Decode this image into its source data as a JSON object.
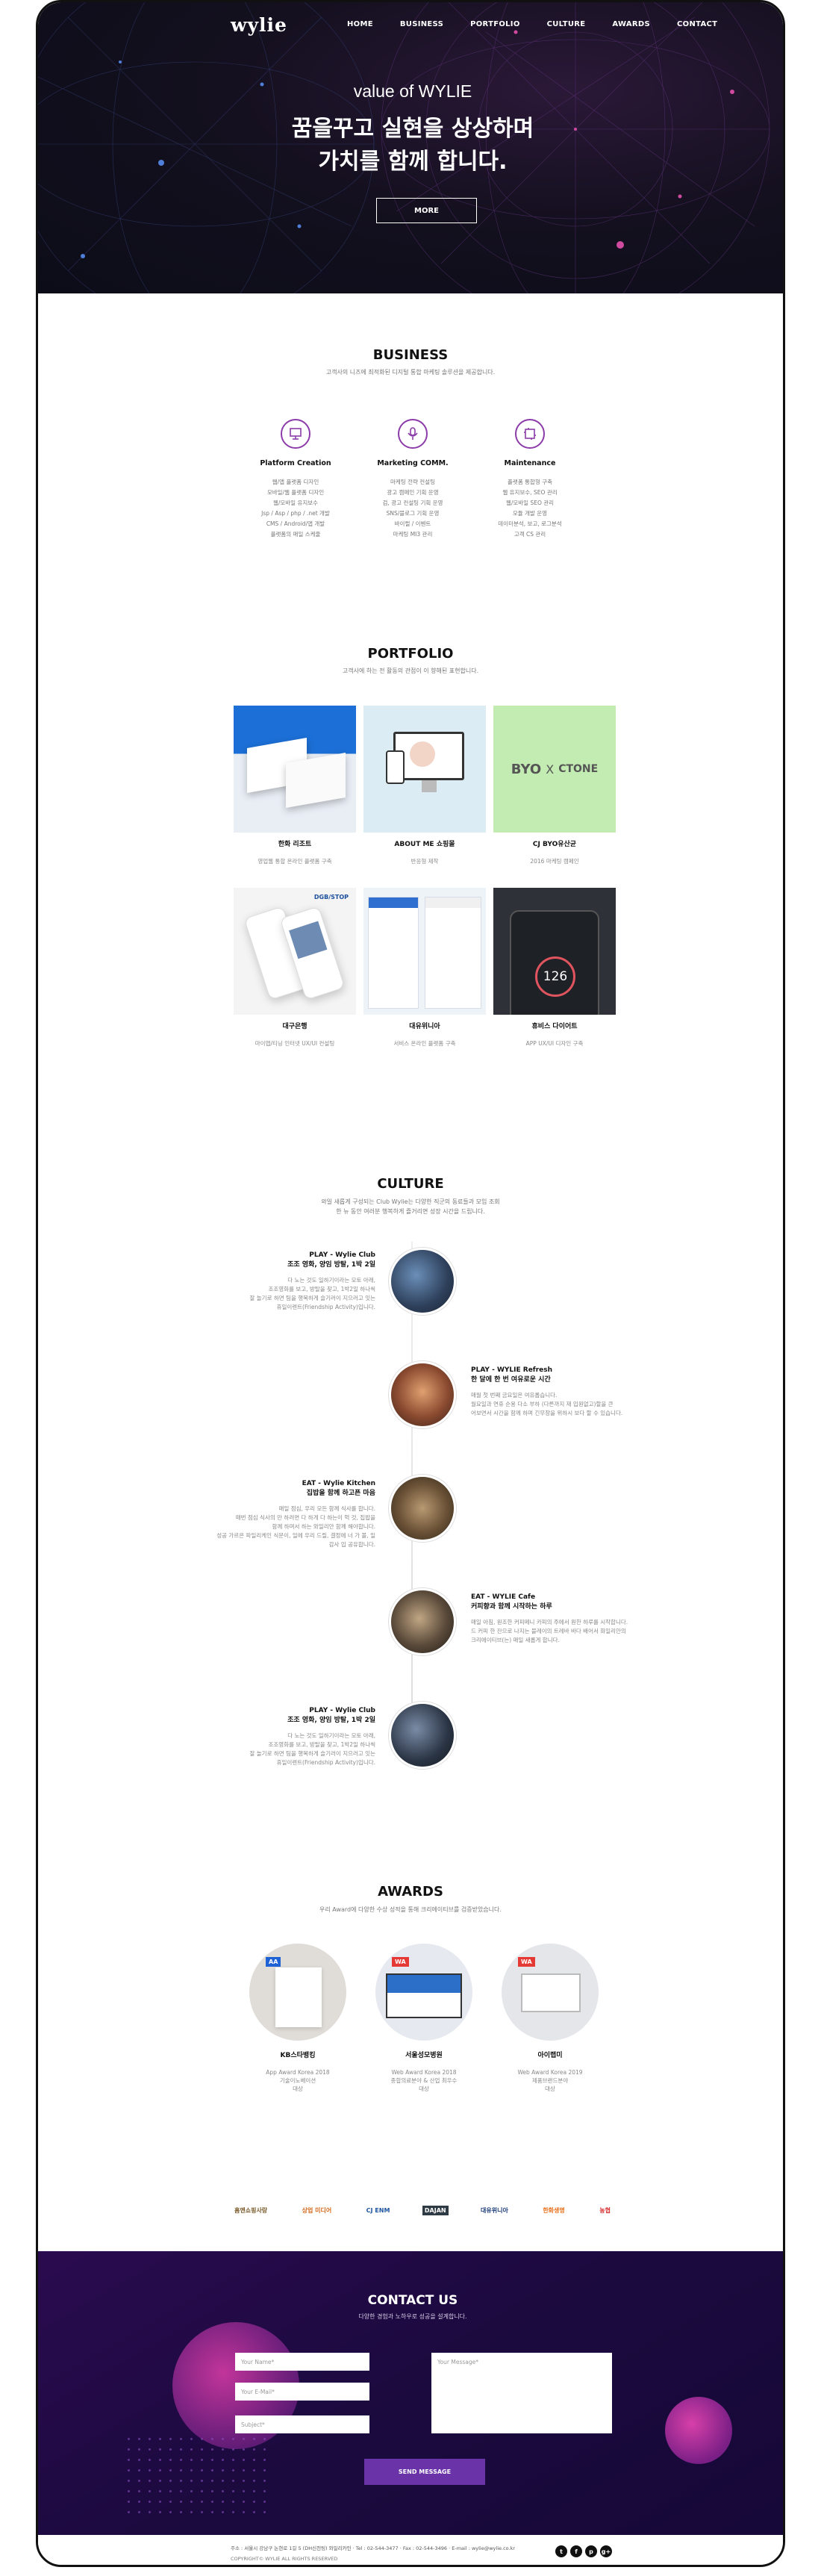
{
  "nav": {
    "logo": "wylie",
    "items": [
      "HOME",
      "BUSINESS",
      "PORTFOLIO",
      "CULTURE",
      "AWARDS",
      "CONTACT"
    ]
  },
  "hero": {
    "subtitle": "value of WYLIE",
    "title_line1": "꿈을꾸고 실현을 상상하며",
    "title_line2": "가치를 함께 합니다.",
    "more_label": "MORE"
  },
  "business": {
    "title": "BUSINESS",
    "desc": "고객사의 니즈에 최적화된 디지털 통합 마케팅 솔루션을 제공합니다.",
    "items": [
      {
        "icon": "platform-icon",
        "name": "Platform Creation",
        "desc": "웹/앱 플랫폼 디자인\n모바일/웹 플랫폼 디자인\n웹/모바일 유지보수\nJsp / Asp / php / .net 개발\nCMS / Android/앱 개발\n플랫폼의 매일 스케줄"
      },
      {
        "icon": "marketing-icon",
        "name": "Marketing COMM.",
        "desc": "마케팅 전략 컨설팅\n광고 캠페인 기획 운영\n검, 광고 컨설팅 기획 운영\nSNS/블로그 기획 운영\n바이럴 / 이벤트\n마케팅 MI3 관리"
      },
      {
        "icon": "maintenance-icon",
        "name": "Maintenance",
        "desc": "플랫폼 통합형 구축\n웹 유지보수, SEO 관리\n웹/모바일 SEO 관리\n모듈 개발 운영\n데이터분석, 보고, 로그분석\n고객 CS 관리"
      }
    ]
  },
  "portfolio": {
    "title": "PORTFOLIO",
    "desc": "고객사에 하는 전 활동의 관점이 이 향해된 표현합니다.",
    "items": [
      {
        "name": "한화 리조트",
        "desc": "영업웹 통합 온라인 플랫폼 구축"
      },
      {
        "name": "ABOUT ME 쇼핑몰",
        "desc": "반응형 제작"
      },
      {
        "name": "CJ BYO유산균",
        "desc": "2016 마케팅 캠페인"
      },
      {
        "name": "대구은행",
        "desc": "마이앱/티닝 인터넷 UX/UI 컨설팅"
      },
      {
        "name": "대유위니아",
        "desc": "서비스 온라인 플랫폼 구축"
      },
      {
        "name": "휴비스 다이어트",
        "desc": "APP UX/UI 디자인 구축"
      }
    ],
    "byo_text": "BYO",
    "x_text": "X",
    "ctone_text": "CTONE",
    "dgb_text": "DGB/STOP",
    "phone_number": "126"
  },
  "culture": {
    "title": "CULTURE",
    "desc_line1": "와일 새롭게 구성되는 Club Wylie는 다양한 직군의 동료들과 모임 조회",
    "desc_line2": "한 뉴 동안 여러분 행복하게 즐거리면 성장 시간을 드립니다.",
    "items": [
      {
        "title": "PLAY - Wylie Club\n조조 영화, 양임 방탈, 1박 2일",
        "desc": "다 노는 것도 일하기이라는 모토 아래,\n조조영화를 보고, 방탈을 찾고, 1박2일 하나씩 \n잘 놀기로 하면 팀을 행복하게 슬기러이 지으러고 잇는\n휴일이렌트(Friendship Activity)입니다."
      },
      {
        "title": "PLAY - WYLIE Refresh\n한 달에 한 번 여유로운 시간",
        "desc": "매월 첫 번째 금요일은 여유롭습니다.\n월요일과 연휴 순용 다소 부하 (다른까지 재 입원없고)할을 큰\n어보면서 시간을 함께 하며 긴무장을 위하시 보다 할 수 있습니다."
      },
      {
        "title": "EAT - Wylie Kitchen\n집밥을 함께 하고픈 마음",
        "desc": "매일 점심, 우리 모든 함께 식사를 합니다.\n매번 점심 식사의 만 하려면 다 하게 다 하는이 먹 것, 집밥을\n함께 하며서 하는 와일리안 함께 해야합니다.\n성공 가르은 파일리케인 식문이, 일에 우리 드릴, 결정에 너 가 볼, 일\n감사 입 공유합니다."
      },
      {
        "title": "EAT - WYLIE Cafe\n커피향과 함께 시작하는 하루",
        "desc": "매일 아침, 원조한 커피메니 카피의 주에서 원한 하루를 시작합니다.\n드 커피 한 잔으로 나지는 블레이의 트레바 바다 배어서 화일리안의\n크리에이티브(는) 매일 새롭게 합니다."
      },
      {
        "title": "PLAY - Wylie Club\n조조 영화, 양임 방탈, 1박 2일",
        "desc": "다 노는 것도 일하기이라는 모토 아래,\n조조영화를 보고, 방탈을 찾고, 1박2일 하나씩\n잘 놀기로 하면 팀을 행복하게 슬기러이 지으러고 잇는\n휴일이렌트(Friendship Activity)입니다."
      }
    ]
  },
  "awards": {
    "title": "AWARDS",
    "desc": "우리 Award에 다양한 수상 성적을 통해 크리에이티브를 검증받았습니다.",
    "items": [
      {
        "badge": "AA",
        "name": "KB스타뱅킹",
        "desc": "App Award Korea 2018\n기술이노베이션\n대상"
      },
      {
        "badge": "WA",
        "name": "서울성모병원",
        "desc": "Web Award Korea 2018\n종합의료분야 & 산업 최우수\n대상"
      },
      {
        "badge": "WA",
        "name": "아이랩미",
        "desc": "Web Award Korea 2019\n제품브랜드분야\n대상"
      }
    ]
  },
  "clients": [
    "홈앤쇼핑사랑",
    "상업 미디어",
    "CJ ENM",
    "DAJAN",
    "대유위니아",
    "한화생명",
    "농협"
  ],
  "contact": {
    "title": "CONTACT US",
    "sub": "다양한 경험과 노하우로 성공을 설계합니다.",
    "name_placeholder": "Your Name*",
    "email_placeholder": "Your E-Mail*",
    "subject_placeholder": "Subject*",
    "message_placeholder": "Your Message*",
    "send_label": "SEND MESSAGE"
  },
  "footer": {
    "line1": "주소 : 서울시 강남구 논현로 1길 5 (DH신천팅) 와일리카인 · Tel : 02-544-3477 · Fax : 02-544-3496 · E-mail : wylie@wylie.co.kr",
    "line2": "COPYRIGHT© WYLIE ALL RIGHTS RESERVED",
    "social": [
      "t",
      "f",
      "p",
      "g+"
    ]
  },
  "colors": {
    "accent": "#8b3ca8",
    "hero_bg": "#0c0c18",
    "contact_bg": "#1b0a3e",
    "button": "#6a33a8"
  }
}
